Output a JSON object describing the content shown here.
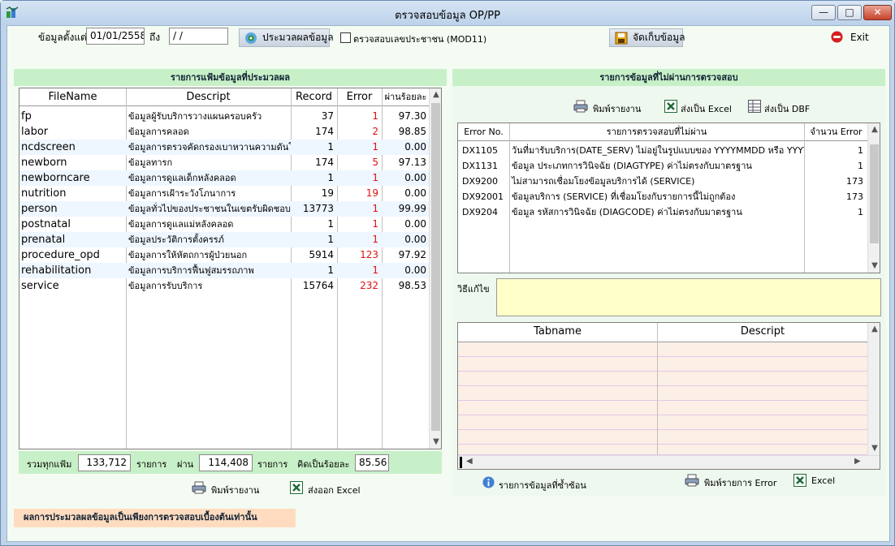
{
  "window": {
    "title": "ตรวจสอบข้อมูล OP/PP"
  },
  "toolbar": {
    "date_from_label": "ข้อมูลตั้งแต่",
    "date_from_value": "01/01/2558",
    "date_to_label": "ถึง",
    "date_to_value": " / /",
    "process_button": "ประมวลผลข้อมูล",
    "check_cid_label": "ตรวจสอบเลขประชาชน (MOD11)",
    "save_button": "จัดเก็บข้อมูล",
    "exit_button": "Exit"
  },
  "left_panel": {
    "title": "รายการแฟ้มข้อมูลที่ประมวลผล",
    "columns": [
      "FileName",
      "Descript",
      "Record",
      "Error",
      "ผ่านร้อยละ"
    ],
    "rows": [
      {
        "file": "fp",
        "desc": "ข้อมูลผู้รับบริการวางแผนครอบครัว",
        "record": "37",
        "error": "1",
        "pass": "97.30"
      },
      {
        "file": "labor",
        "desc": "ข้อมูลการคลอด",
        "record": "174",
        "error": "2",
        "pass": "98.85"
      },
      {
        "file": "ncdscreen",
        "desc": "ข้อมูลการตรวจคัดกรองเบาหวานความดันโล",
        "record": "1",
        "error": "1",
        "pass": "0.00"
      },
      {
        "file": "newborn",
        "desc": "ข้อมูลทารก",
        "record": "174",
        "error": "5",
        "pass": "97.13"
      },
      {
        "file": "newborncare",
        "desc": "ข้อมูลการดูแลเด็กหลังคลอด",
        "record": "1",
        "error": "1",
        "pass": "0.00"
      },
      {
        "file": "nutrition",
        "desc": "ข้อมูลการเฝ้าระวังโภนาการ",
        "record": "19",
        "error": "19",
        "pass": "0.00"
      },
      {
        "file": "person",
        "desc": "ข้อมูลทั่วไปของประชาชนในเขตรับผิดชอบแ",
        "record": "13773",
        "error": "1",
        "pass": "99.99"
      },
      {
        "file": "postnatal",
        "desc": "ข้อมูลการดูแลแม่หลังคลอด",
        "record": "1",
        "error": "1",
        "pass": "0.00"
      },
      {
        "file": "prenatal",
        "desc": "ข้อมูลประวัติการตั้งครรภ์",
        "record": "1",
        "error": "1",
        "pass": "0.00"
      },
      {
        "file": "procedure_opd",
        "desc": "ข้อมูลการให้หัตถการผู้ป่วยนอก",
        "record": "5914",
        "error": "123",
        "pass": "97.92"
      },
      {
        "file": "rehabilitation",
        "desc": "ข้อมูลการบริการฟื้นฟูสมรรถภาพ",
        "record": "1",
        "error": "1",
        "pass": "0.00"
      },
      {
        "file": "service",
        "desc": "ข้อมูลการรับบริการ",
        "record": "15764",
        "error": "232",
        "pass": "98.53"
      }
    ],
    "summary": {
      "total_label": "รวมทุกแฟ้ม",
      "total_value": "133,712",
      "unit1": "รายการ",
      "pass_label": "ผ่าน",
      "pass_value": "114,408",
      "unit2": "รายการ",
      "percent_label": "คิดเป็นร้อยละ",
      "percent_value": "85.56"
    },
    "print_button": "พิมพ์รายงาน",
    "excel_button": "ส่งออก Excel"
  },
  "right_panel": {
    "title": "รายการข้อมูลที่ไม่ผ่านการตรวจสอบ",
    "print_button": "พิมพ์รายงาน",
    "excel_button": "ส่งเป็น Excel",
    "dbf_button": "ส่งเป็น DBF",
    "columns": [
      "Error No.",
      "รายการตรวจสอบที่ไม่ผ่าน",
      "จำนวน Error"
    ],
    "rows": [
      {
        "code": "DX1105",
        "desc": "วันที่มารับบริการ(DATE_SERV) ไม่อยู่ในรูปแบบของ YYYYMMDD หรือ YYYY",
        "count": "1"
      },
      {
        "code": "DX1131",
        "desc": "ข้อมูล ประเภทการวินิจฉัย (DIAGTYPE) ค่าไม่ตรงกับมาตรฐาน",
        "count": "1"
      },
      {
        "code": "DX9200",
        "desc": "ไม่สามารถเชื่อมโยงข้อมูลบริการได้ (SERVICE)",
        "count": "173"
      },
      {
        "code": "DX92001",
        "desc": "ข้อมูลบริการ (SERVICE) ที่เชื่อมโยงกับรายการนี้ไม่ถูกต้อง",
        "count": "173"
      },
      {
        "code": "DX9204",
        "desc": "ข้อมูล รหัสการวินิจฉัย (DIAGCODE) ค่าไม่ตรงกับมาตรฐาน",
        "count": "1"
      }
    ],
    "fix_label": "วิธีแก้ไข",
    "detail_columns": [
      "Tabname",
      "Descript"
    ],
    "duplicate_button": "รายการข้อมูลที่ซ้ำซ้อน",
    "print_error_button": "พิมพ์รายการ Error",
    "excel_button2": "Excel"
  },
  "footer": {
    "note": "ผลการประมวลผลข้อมูลเป็นเพียงการตรวจสอบเบื้องต้นเท่านั้น"
  },
  "colors": {
    "error_red": "#e01010",
    "panel_green": "#c8f0c8",
    "note_yellow": "#ffffc8"
  }
}
